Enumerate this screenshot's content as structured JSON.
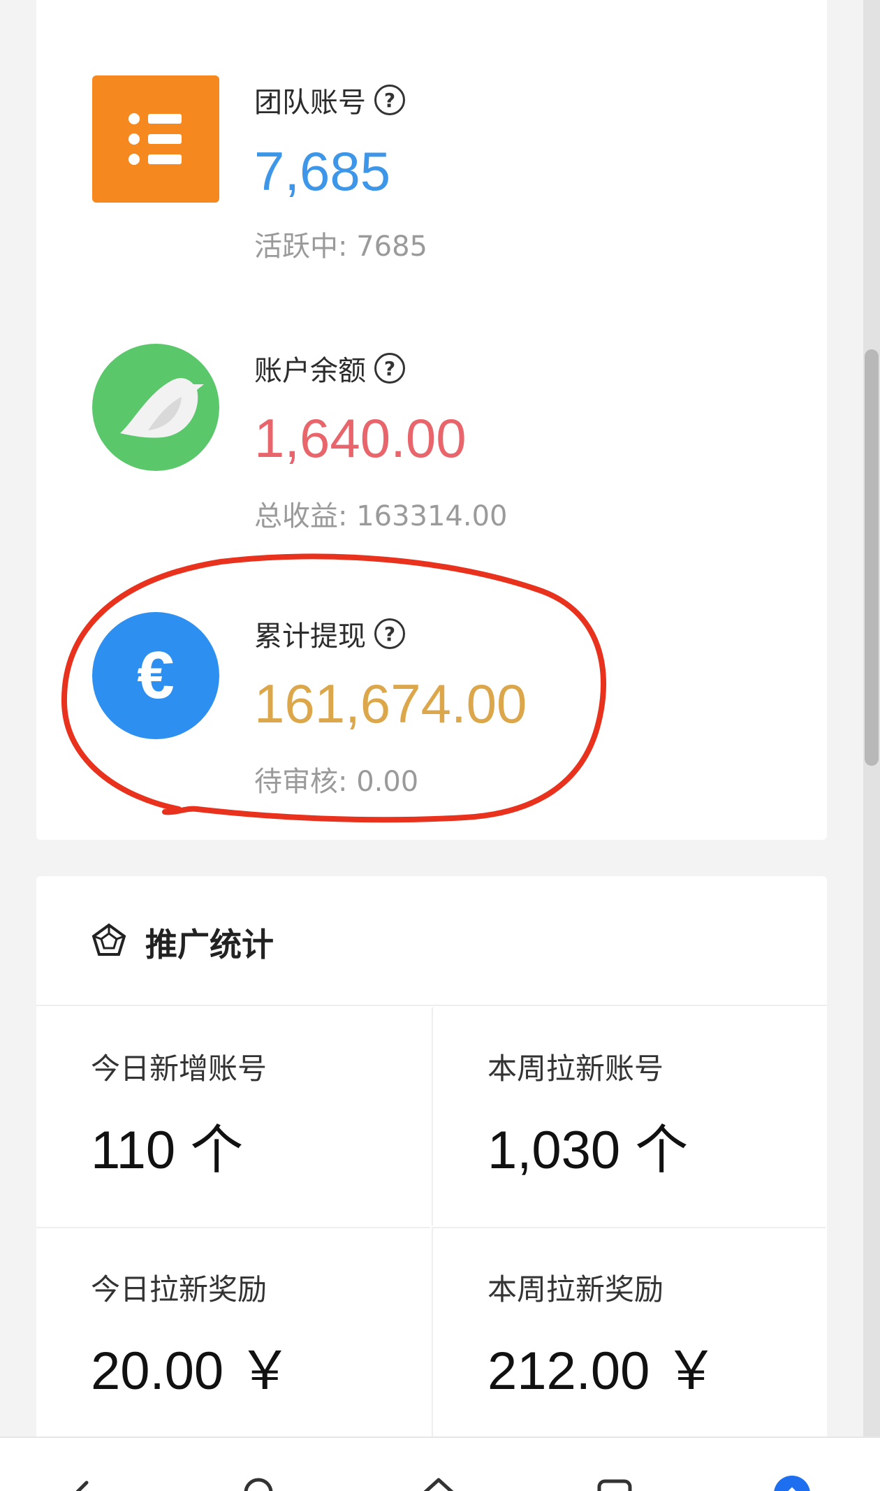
{
  "team": {
    "label": "团队账号",
    "value": "7,685",
    "sub": "活跃中: 7685",
    "value_color": "#3d96e8"
  },
  "balance": {
    "label": "账户余额",
    "value": "1,640.00",
    "sub": "总收益: 163314.00",
    "value_color": "#e8666b"
  },
  "withdraw": {
    "label": "累计提现",
    "value": "161,674.00",
    "sub": "待审核: 0.00",
    "value_color": "#dca64a"
  },
  "help_glyph": "?",
  "promo": {
    "title": "推广统计",
    "cells": [
      {
        "label": "今日新增账号",
        "value": "110 个"
      },
      {
        "label": "本周拉新账号",
        "value": "1,030 个"
      },
      {
        "label": "今日拉新奖励",
        "value": "20.00 ￥"
      },
      {
        "label": "本周拉新奖励",
        "value": "212.00 ￥"
      }
    ]
  },
  "icons": {
    "team": "list-icon",
    "balance": "bird-icon",
    "withdraw": "euro-icon",
    "promo": "pentagon-badge-icon"
  },
  "euro_glyph": "€",
  "annotation_color": "#e8321e"
}
